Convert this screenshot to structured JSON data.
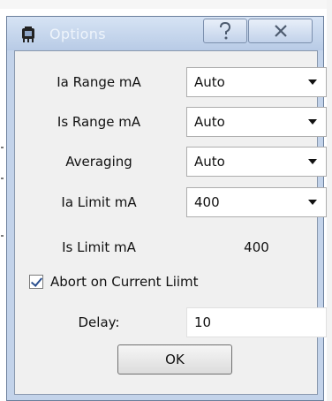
{
  "window": {
    "title": "Options",
    "icon": "app-icon",
    "help_icon": "question-icon",
    "close_icon": "close-icon"
  },
  "fields": {
    "ia_range": {
      "label": "Ia Range mA",
      "value": "Auto"
    },
    "is_range": {
      "label": "Is Range mA",
      "value": "Auto"
    },
    "averaging": {
      "label": "Averaging",
      "value": "Auto"
    },
    "ia_limit": {
      "label": "Ia Limit mA",
      "value": "400"
    },
    "is_limit": {
      "label": "Is Limit mA",
      "value": "400"
    }
  },
  "abort": {
    "label": "Abort on Current Liimt",
    "checked": true
  },
  "delay": {
    "label": "Delay:",
    "value": "10"
  },
  "ok_label": "OK",
  "colors": {
    "titlebar": "#c3d3ea",
    "client": "#f0f0f0",
    "check": "#2a4f8f"
  }
}
